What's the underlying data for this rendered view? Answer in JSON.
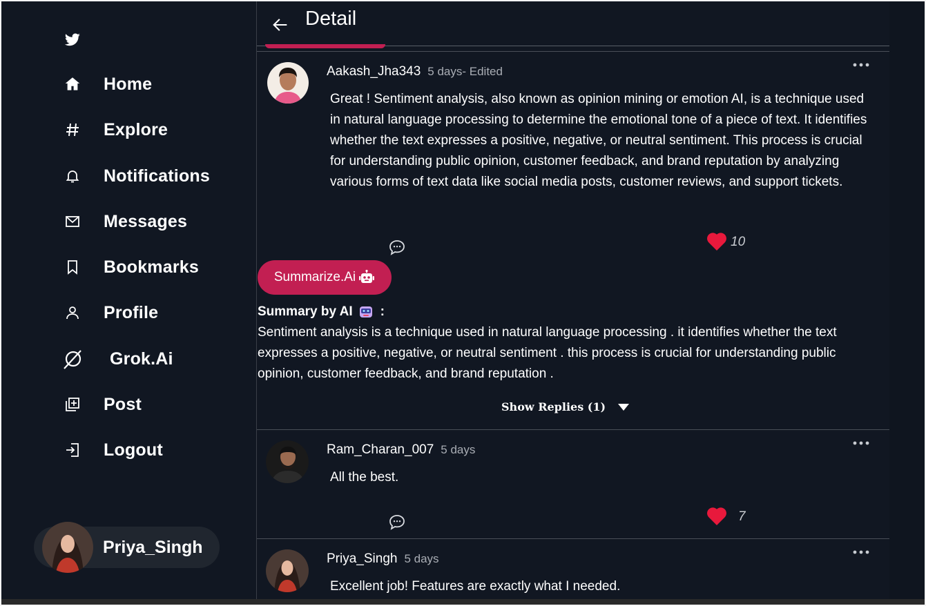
{
  "sidebar": {
    "brand_icon": "twitter-bird-icon",
    "items": [
      {
        "label": "Home",
        "icon": "home-icon"
      },
      {
        "label": "Explore",
        "icon": "hashtag-icon"
      },
      {
        "label": "Notifications",
        "icon": "bell-icon"
      },
      {
        "label": "Messages",
        "icon": "mail-icon"
      },
      {
        "label": "Bookmarks",
        "icon": "bookmark-icon"
      },
      {
        "label": "Profile",
        "icon": "user-icon"
      },
      {
        "label": "Grok.Ai",
        "icon": "grok-icon"
      },
      {
        "label": "Post",
        "icon": "post-icon"
      },
      {
        "label": "Logout",
        "icon": "logout-icon"
      }
    ],
    "current_user": {
      "name": "Priya_Singh"
    }
  },
  "header": {
    "title": "Detail",
    "back_icon": "arrow-left-icon"
  },
  "post": {
    "username": "Aakash_Jha343",
    "timestamp": "5 days- Edited",
    "body": "Great ! Sentiment analysis, also known as opinion mining or emotion AI, is a technique used in natural language processing to determine the emotional tone of a piece of text. It identifies whether the text expresses a positive, negative, or neutral sentiment. This process is crucial for understanding public opinion, customer feedback, and brand reputation by analyzing various forms of text data like social media posts, customer reviews, and support tickets.",
    "likes": "10"
  },
  "summarize_button": {
    "label": "Summarize.Ai",
    "icon": "robot-icon"
  },
  "summary": {
    "heading": "Summary by AI",
    "colon": ":",
    "text": "Sentiment analysis is a technique used in natural language processing . it identifies whether the text expresses a positive, negative, or neutral sentiment . this process is crucial for understanding public opinion, customer feedback, and brand reputation ."
  },
  "show_replies": {
    "label": "Show Replies (1)"
  },
  "replies": [
    {
      "username": "Ram_Charan_007",
      "timestamp": "5 days",
      "body": "All the best.",
      "likes": "7"
    },
    {
      "username": "Priya_Singh",
      "timestamp": "5 days",
      "body": "Excellent job! Features are exactly what I needed."
    }
  ],
  "colors": {
    "accent": "#c21f52",
    "background": "#111722",
    "heart": "#e8193c",
    "pill": "#20262f"
  }
}
